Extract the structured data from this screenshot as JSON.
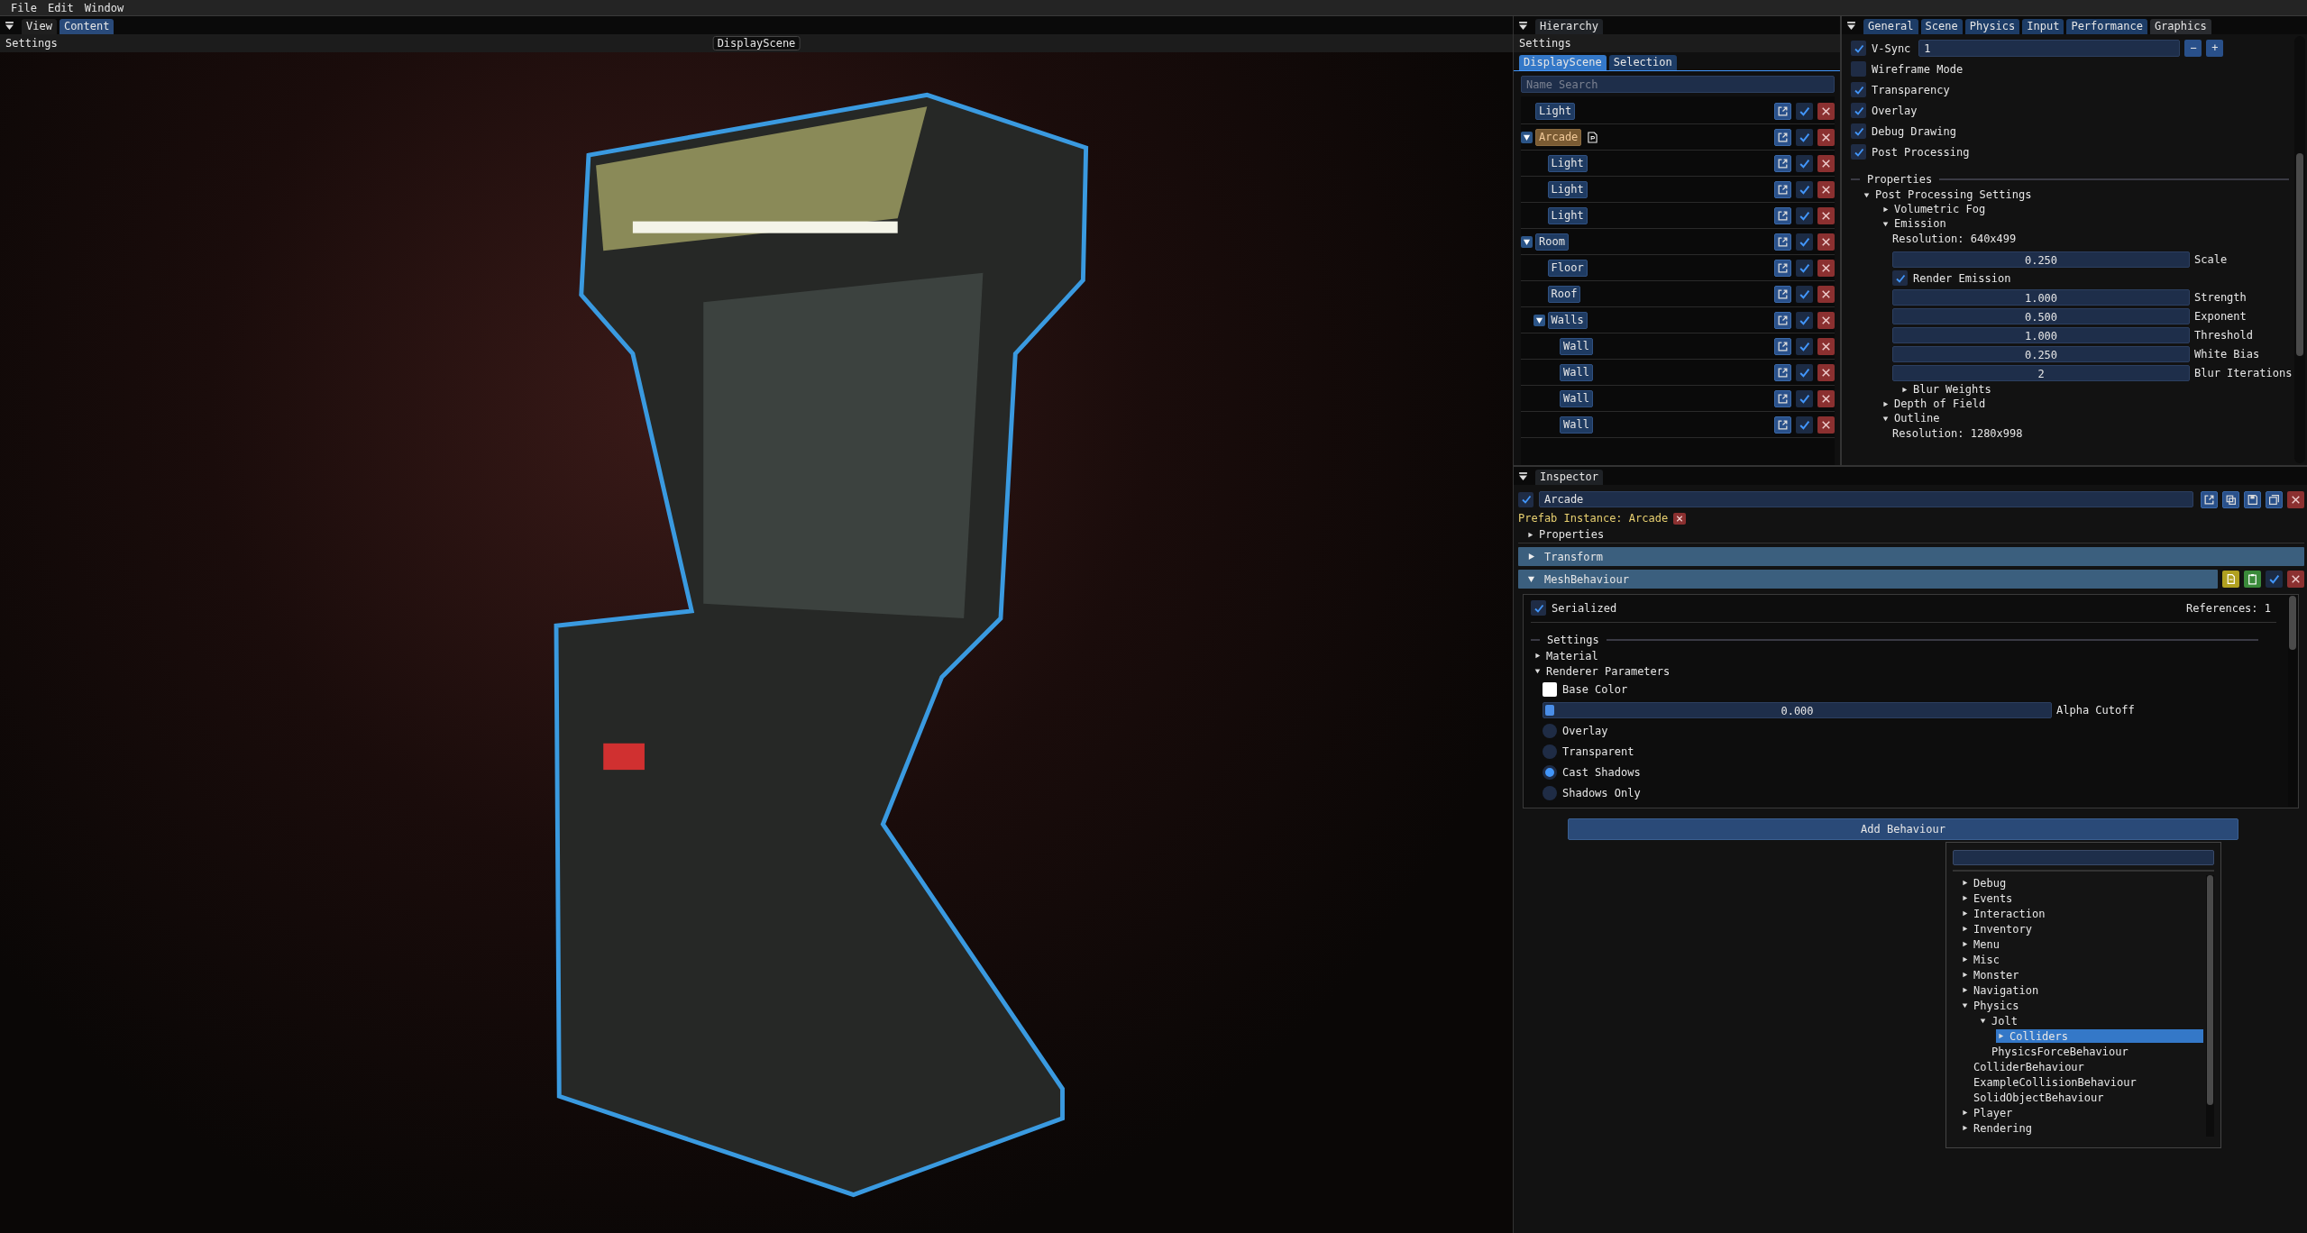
{
  "menu_bar": [
    "File",
    "Edit",
    "Window"
  ],
  "viewport": {
    "tabs": [
      {
        "label": "View",
        "selected": false
      },
      {
        "label": "Content",
        "selected": true
      }
    ],
    "menu": "Settings",
    "scene_label": "DisplayScene"
  },
  "hierarchy": {
    "title": "Hierarchy",
    "menu": "Settings",
    "tabs": [
      {
        "label": "DisplayScene",
        "selected": true
      },
      {
        "label": "Selection",
        "selected": false
      }
    ],
    "search": {
      "placeholder": "Name Search"
    },
    "items": [
      {
        "name": "Light",
        "kind": "object",
        "enabled": true
      },
      {
        "name": "Arcade",
        "kind": "prefab",
        "enabled": true,
        "expanded": true,
        "children": [
          {
            "name": "Light",
            "kind": "object",
            "enabled": true
          },
          {
            "name": "Light",
            "kind": "object",
            "enabled": true
          },
          {
            "name": "Light",
            "kind": "object",
            "enabled": true
          }
        ]
      },
      {
        "name": "Room",
        "kind": "object",
        "enabled": true,
        "expanded": true,
        "children": [
          {
            "name": "Floor",
            "kind": "object",
            "enabled": true
          },
          {
            "name": "Roof",
            "kind": "object",
            "enabled": true
          },
          {
            "name": "Walls",
            "kind": "object",
            "enabled": true,
            "expanded": true,
            "children": [
              {
                "name": "Wall",
                "kind": "object",
                "enabled": true
              },
              {
                "name": "Wall",
                "kind": "object",
                "enabled": true
              },
              {
                "name": "Wall",
                "kind": "object",
                "enabled": true
              },
              {
                "name": "Wall",
                "kind": "object",
                "enabled": true
              }
            ]
          }
        ]
      }
    ]
  },
  "graphics": {
    "tabs": [
      {
        "label": "General",
        "selected": false
      },
      {
        "label": "Scene",
        "selected": false
      },
      {
        "label": "Physics",
        "selected": false
      },
      {
        "label": "Input",
        "selected": false
      },
      {
        "label": "Performance",
        "selected": false
      },
      {
        "label": "Graphics",
        "selected": true
      }
    ],
    "vsync": {
      "label": "V-Sync",
      "checked": true,
      "value": "1",
      "minus": "−",
      "plus": "+"
    },
    "toggles": [
      {
        "label": "Wireframe Mode",
        "checked": false
      },
      {
        "label": "Transparency",
        "checked": true
      },
      {
        "label": "Overlay",
        "checked": true
      },
      {
        "label": "Debug Drawing",
        "checked": true
      },
      {
        "label": "Post Processing",
        "checked": true
      }
    ],
    "section": "Properties",
    "tree": [
      {
        "kind": "node",
        "label": "Post Processing Settings",
        "expanded": true,
        "children": [
          {
            "kind": "node",
            "label": "Volumetric Fog",
            "expanded": false
          },
          {
            "kind": "node",
            "label": "Emission",
            "expanded": true,
            "children": [
              {
                "kind": "text",
                "text": "Resolution: 640x499"
              },
              {
                "kind": "drag",
                "value": "0.250",
                "label": "Scale"
              },
              {
                "kind": "checkbox",
                "label": "Render Emission",
                "checked": true
              },
              {
                "kind": "drag",
                "value": "1.000",
                "label": "Strength"
              },
              {
                "kind": "drag",
                "value": "0.500",
                "label": "Exponent"
              },
              {
                "kind": "drag",
                "value": "1.000",
                "label": "Threshold"
              },
              {
                "kind": "drag",
                "value": "0.250",
                "label": "White Bias"
              },
              {
                "kind": "drag",
                "value": "2",
                "label": "Blur Iterations"
              },
              {
                "kind": "node",
                "label": "Blur Weights",
                "expanded": false
              }
            ]
          },
          {
            "kind": "node",
            "label": "Depth of Field",
            "expanded": false
          },
          {
            "kind": "node",
            "label": "Outline",
            "expanded": true,
            "children": [
              {
                "kind": "text",
                "text": "Resolution: 1280x998"
              }
            ]
          }
        ]
      }
    ]
  },
  "inspector": {
    "title": "Inspector",
    "enabled": true,
    "name": "Arcade",
    "prefab_label": "Prefab Instance: Arcade",
    "properties": {
      "label": "Properties",
      "expanded": false
    },
    "components": [
      {
        "label": "Transform",
        "expanded": false
      },
      {
        "label": "MeshBehaviour",
        "expanded": true,
        "enabled": true
      }
    ],
    "mesh": {
      "serialized": {
        "label": "Serialized",
        "checked": true
      },
      "references": "References: 1",
      "section": "Settings",
      "material": {
        "label": "Material",
        "expanded": false
      },
      "renderer": {
        "label": "Renderer Parameters",
        "expanded": true
      },
      "base_color": "Base Color",
      "alpha": {
        "value": "0.000",
        "label": "Alpha Cutoff",
        "level": 0
      },
      "modes": [
        {
          "label": "Overlay",
          "selected": false
        },
        {
          "label": "Transparent",
          "selected": false
        },
        {
          "label": "Cast Shadows",
          "selected": true
        },
        {
          "label": "Shadows Only",
          "selected": false
        }
      ]
    },
    "add_button": "Add Behaviour",
    "popup": {
      "items": [
        {
          "label": "Debug",
          "expanded": false,
          "selected": false
        },
        {
          "label": "Events",
          "expanded": false,
          "selected": false
        },
        {
          "label": "Interaction",
          "expanded": false,
          "selected": false
        },
        {
          "label": "Inventory",
          "expanded": false,
          "selected": false
        },
        {
          "label": "Menu",
          "expanded": false,
          "selected": false
        },
        {
          "label": "Misc",
          "expanded": false,
          "selected": false
        },
        {
          "label": "Monster",
          "expanded": false,
          "selected": false
        },
        {
          "label": "Navigation",
          "expanded": false,
          "selected": false
        },
        {
          "label": "Physics",
          "expanded": true,
          "selected": false,
          "children": [
            {
              "label": "Jolt",
              "expanded": true,
              "selected": false,
              "children": [
                {
                  "label": "Colliders",
                  "expanded": false,
                  "selected": true
                },
                {
                  "label": "PhysicsForceBehaviour",
                  "kind": "leaf",
                  "selected": false
                }
              ]
            },
            {
              "label": "ColliderBehaviour",
              "kind": "leaf",
              "selected": false
            },
            {
              "label": "ExampleCollisionBehaviour",
              "kind": "leaf",
              "selected": false
            },
            {
              "label": "SolidObjectBehaviour",
              "kind": "leaf",
              "selected": false
            }
          ]
        },
        {
          "label": "Player",
          "expanded": false,
          "selected": false
        },
        {
          "label": "Rendering",
          "expanded": false,
          "selected": false
        }
      ]
    }
  }
}
